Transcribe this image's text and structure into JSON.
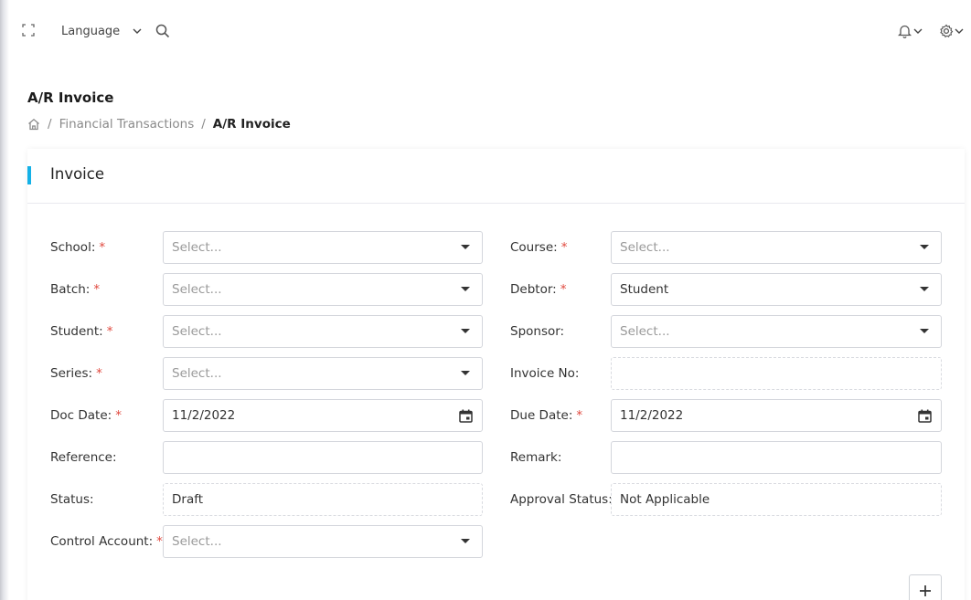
{
  "topbar": {
    "language_label": "Language",
    "icons": {
      "fullscreen": "fullscreen-icon",
      "chevron": "chevron-down-icon",
      "search": "search-icon",
      "bell": "bell-icon",
      "gear": "gear-icon"
    }
  },
  "page": {
    "title": "A/R Invoice",
    "breadcrumb": {
      "home_icon": "home-icon",
      "separator": "/",
      "items": [
        "Financial Transactions",
        "A/R Invoice"
      ]
    }
  },
  "card": {
    "title": "Invoice",
    "accent_color": "#14b1e7"
  },
  "form": {
    "required_mark": "*",
    "school": {
      "label": "School:",
      "placeholder": "Select..."
    },
    "batch": {
      "label": "Batch:",
      "placeholder": "Select..."
    },
    "student": {
      "label": "Student:",
      "placeholder": "Select..."
    },
    "series": {
      "label": "Series:",
      "placeholder": "Select..."
    },
    "doc_date": {
      "label": "Doc Date:",
      "value": "11/2/2022"
    },
    "reference": {
      "label": "Reference:",
      "value": ""
    },
    "status": {
      "label": "Status:",
      "value": "Draft"
    },
    "control_account": {
      "label": "Control Account:",
      "placeholder": "Select..."
    },
    "course": {
      "label": "Course:",
      "placeholder": "Select..."
    },
    "debtor": {
      "label": "Debtor:",
      "value": "Student"
    },
    "sponsor": {
      "label": "Sponsor:",
      "placeholder": "Select..."
    },
    "invoice_no": {
      "label": "Invoice No:",
      "value": ""
    },
    "due_date": {
      "label": "Due Date:",
      "value": "11/2/2022"
    },
    "remark": {
      "label": "Remark:",
      "value": ""
    },
    "approval_status": {
      "label": "Approval Status:",
      "value": "Not Applicable"
    }
  },
  "actions": {
    "add_icon": "plus-icon"
  }
}
